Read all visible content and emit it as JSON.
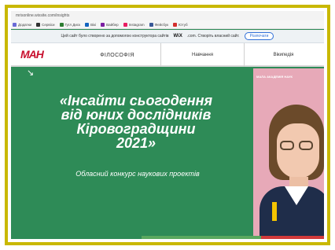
{
  "browser": {
    "url": "mrisonline.wixsite.com/insights",
    "bookmarks": [
      {
        "label": "Додатки",
        "icon": "apps-icon",
        "color": "#6b6bd6"
      },
      {
        "label": "Сервіси",
        "icon": "bookmark-icon",
        "color": "#333333"
      },
      {
        "label": "Гугл Диск",
        "icon": "drive-icon",
        "color": "#2e7d32"
      },
      {
        "label": "Вікі",
        "icon": "wiki-icon",
        "color": "#1565c0"
      },
      {
        "label": "Вайбер",
        "icon": "viber-icon",
        "color": "#7b1fa2"
      },
      {
        "label": "Instagram",
        "icon": "instagram-icon",
        "color": "#e91e63"
      },
      {
        "label": "Фейсбук",
        "icon": "facebook-icon",
        "color": "#3b5998"
      },
      {
        "label": "Ютуб",
        "icon": "youtube-icon",
        "color": "#d32f2f"
      }
    ]
  },
  "wix_banner": {
    "text": "Цей сайт було створено за допомогою конструктора сайтів",
    "brand": "WiX",
    "text_after": ".com. Створіть власний сайт.",
    "button_label": "Розпочати"
  },
  "site": {
    "logo": "МАН",
    "nav": {
      "main": "ФІЛОСОФІЯ",
      "item2": "Навчання",
      "item3": "Вікипедія"
    }
  },
  "hero": {
    "arrow": "↘",
    "headline_line1": "«Інсайти сьогодення",
    "headline_line2": "від юних дослідників",
    "headline_line3": "Кіровоградщини",
    "headline_line4": "2021»",
    "subline": "Обласний конкурс наукових проектів",
    "photo_label": "МАЛА АКАДЕМІЯ НАУК"
  },
  "colors": {
    "hero_bg": "#2e8b57",
    "frame": "#c9b800",
    "brand_red": "#c8102e"
  }
}
